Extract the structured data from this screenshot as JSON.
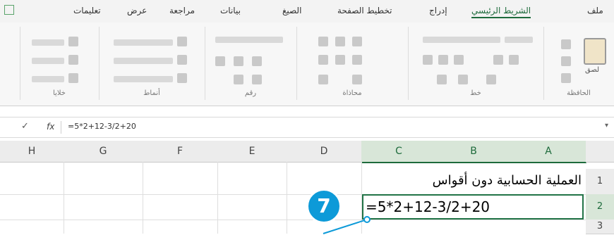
{
  "ribbon": {
    "tabs": [
      "ملف",
      "الشريط الرئيسي",
      "إدراج",
      "تخطيط الصفحة",
      "الصيغ",
      "بيانات",
      "مراجعة",
      "عرض",
      "تعليمات"
    ],
    "groups": [
      "الحافظة",
      "خط",
      "محاذاة",
      "رقم",
      "أنماط",
      "خلايا"
    ],
    "paste_label": "لصق"
  },
  "formula_bar": {
    "fx": "fx",
    "check": "✓",
    "formula": "=5*2+12-3/2+20"
  },
  "grid": {
    "columns": [
      "A",
      "B",
      "C",
      "D",
      "E",
      "F",
      "G",
      "H"
    ],
    "rows": [
      "1",
      "2",
      "3"
    ],
    "cell_A1": "العملية الحسابية دون أقواس",
    "cell_A2": "=5*2+12-3/2+20"
  },
  "callout": {
    "step": "7"
  },
  "colors": {
    "accent": "#217346",
    "badge": "#0d9ad8"
  }
}
